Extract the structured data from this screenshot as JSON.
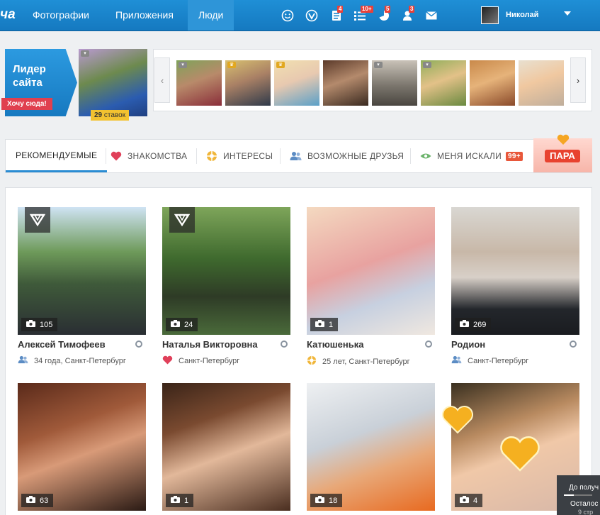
{
  "topbar": {
    "logo": "ча",
    "nav": [
      "Фотографии",
      "Приложения",
      "Люди"
    ],
    "active_nav": "Люди",
    "badges": {
      "guests": "4",
      "events": "10+",
      "notifications": "5",
      "friends": "3"
    },
    "user_name": "Николай",
    "colors": {
      "bar": "#1a84cc",
      "badge": "#e8413a"
    }
  },
  "leader": {
    "title": "Лидер сайта",
    "cta": "Хочу сюда!",
    "bids_count": "29",
    "bids_word": "ставок"
  },
  "strip": {
    "prev_icon": "chevron-left-icon",
    "next_icon": "chevron-right-icon"
  },
  "tabs": {
    "recommended": "Рекомендуемые",
    "dating": "Знакомства",
    "interests": "Интересы",
    "possible_friends": "Возможные друзья",
    "searched_me": "Меня искали",
    "searched_badge": "99+"
  },
  "para_banner": "ПАРА",
  "people": [
    {
      "name": "Алексей Тимофеев",
      "photos": "105",
      "info": "34 года, Санкт-Петербург",
      "info_icon": "people-icon",
      "vip": true
    },
    {
      "name": "Наталья Викторовна",
      "photos": "24",
      "info": "Санкт-Петербург",
      "info_icon": "heart-icon",
      "vip": true
    },
    {
      "name": "Катюшенька",
      "photos": "1",
      "info": "25 лет, Санкт-Петербург",
      "info_icon": "interests-icon",
      "vip": false
    },
    {
      "name": "Родион",
      "photos": "269",
      "info": "Санкт-Петербург",
      "info_icon": "people-icon",
      "vip": false
    },
    {
      "photos": "63"
    },
    {
      "photos": "1"
    },
    {
      "photos": "18"
    },
    {
      "photos": "4"
    }
  ],
  "corner_popup": {
    "line1": "До получ",
    "line2": "Осталос",
    "line3": "9 стр"
  }
}
